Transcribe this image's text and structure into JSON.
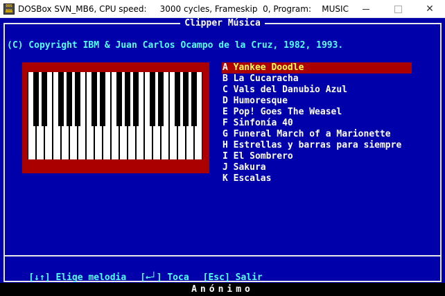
{
  "window": {
    "title": "DOSBox SVN_MB6, CPU speed:     3000 cycles, Frameskip  0, Program:    MUSIC",
    "icon_label": "DOS BOX",
    "minimize_glyph": "",
    "maximize_glyph": "",
    "close_glyph": "✕"
  },
  "screen": {
    "title": "Clipper Música",
    "copyright": "(C) Copyright IBM & Juan Carlos Ocampo de la Cruz, 1982, 1993."
  },
  "menu": {
    "items": [
      {
        "letter": "A",
        "title": "Yankee Doodle",
        "selected": true
      },
      {
        "letter": "B",
        "title": "La Cucaracha"
      },
      {
        "letter": "C",
        "title": "Vals del Danubio Azul"
      },
      {
        "letter": "D",
        "title": "Humoresque"
      },
      {
        "letter": "E",
        "title": "Pop! Goes The Weasel"
      },
      {
        "letter": "F",
        "title": "Sinfonía 40"
      },
      {
        "letter": "G",
        "title": "Funeral March of a Marionette"
      },
      {
        "letter": "H",
        "title": "Estrellas y barras para siempre"
      },
      {
        "letter": "I",
        "title": "El Sombrero"
      },
      {
        "letter": "J",
        "title": "Sakura"
      },
      {
        "letter": "K",
        "title": "Escalas"
      }
    ]
  },
  "help": {
    "choose": "[↓↑] Elige melodia",
    "play": "[←┘] Toca",
    "exit": "[Esc] Salir"
  },
  "status": {
    "text": "Anónimo"
  },
  "piano": {
    "white_keys": 21,
    "black_key_pattern": [
      1,
      1,
      0,
      1,
      1,
      1,
      0,
      1,
      1,
      0,
      1,
      1,
      1,
      0,
      1,
      1,
      0,
      1,
      1,
      1
    ]
  },
  "colors": {
    "dos_background": "#0000aa",
    "cyan_text": "#55ffff",
    "selection": "#aa0000",
    "selected_text": "#ffff55",
    "piano_frame": "#aa0000"
  }
}
